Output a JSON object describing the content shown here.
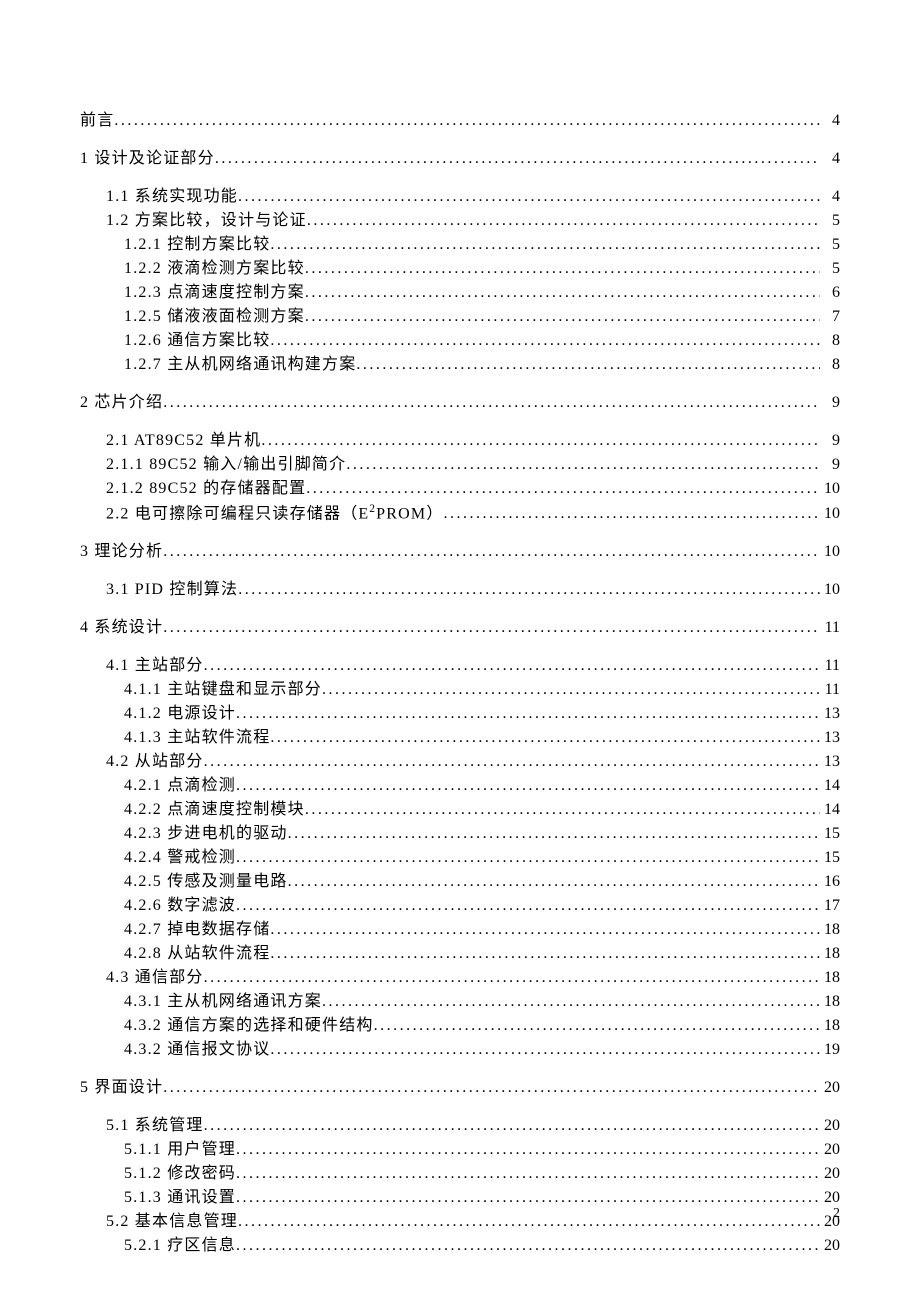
{
  "toc": [
    {
      "label": "前言",
      "page": "4",
      "level": 0
    },
    {
      "label": "1 设计及论证部分",
      "page": "4",
      "level": 0
    },
    {
      "label": "1.1 系统实现功能",
      "page": "4",
      "level": 1
    },
    {
      "label": "1.2 方案比较，设计与论证",
      "page": "5",
      "level": 1
    },
    {
      "label": "1.2.1 控制方案比较",
      "page": "5",
      "level": 2
    },
    {
      "label": "1.2.2 液滴检测方案比较",
      "page": "5",
      "level": 2
    },
    {
      "label": "1.2.3 点滴速度控制方案",
      "page": "6",
      "level": 2
    },
    {
      "label": "1.2.5 储液液面检测方案",
      "page": "7",
      "level": 2
    },
    {
      "label": "1.2.6 通信方案比较",
      "page": "8",
      "level": 2
    },
    {
      "label": "1.2.7 主从机网络通讯构建方案",
      "page": "8",
      "level": 2
    },
    {
      "label": "2 芯片介绍",
      "page": "9",
      "level": 0
    },
    {
      "label": "2.1 AT89C52 单片机",
      "page": "9",
      "level": 1
    },
    {
      "label": "2.1.1 89C52 输入/输出引脚简介",
      "page": "9",
      "level": 1
    },
    {
      "label": "2.1.2 89C52 的存储器配置",
      "page": "10",
      "level": 1
    },
    {
      "label": "2.2 电可擦除可编程只读存储器（E²PROM）",
      "page": "10",
      "level": 1,
      "html": "2.2 电可擦除可编程只读存储器（E<sup>2</sup>PROM）"
    },
    {
      "label": "3 理论分析",
      "page": "10",
      "level": 0
    },
    {
      "label": "3.1 PID 控制算法",
      "page": "10",
      "level": 1
    },
    {
      "label": "4 系统设计",
      "page": "11",
      "level": 0
    },
    {
      "label": "4.1 主站部分",
      "page": "11",
      "level": 1
    },
    {
      "label": "4.1.1 主站键盘和显示部分",
      "page": "11",
      "level": 2
    },
    {
      "label": "4.1.2 电源设计",
      "page": "13",
      "level": 2
    },
    {
      "label": "4.1.3 主站软件流程",
      "page": "13",
      "level": 2
    },
    {
      "label": "4.2 从站部分",
      "page": "13",
      "level": 1
    },
    {
      "label": "4.2.1 点滴检测",
      "page": "14",
      "level": 2
    },
    {
      "label": "4.2.2 点滴速度控制模块",
      "page": "14",
      "level": 2
    },
    {
      "label": "4.2.3 步进电机的驱动",
      "page": "15",
      "level": 2
    },
    {
      "label": "4.2.4 警戒检测",
      "page": "15",
      "level": 2
    },
    {
      "label": "4.2.5 传感及测量电路",
      "page": "16",
      "level": 2
    },
    {
      "label": "4.2.6 数字滤波",
      "page": "17",
      "level": 2
    },
    {
      "label": "4.2.7 掉电数据存储",
      "page": "18",
      "level": 2
    },
    {
      "label": "4.2.8 从站软件流程",
      "page": "18",
      "level": 2
    },
    {
      "label": "4.3 通信部分",
      "page": "18",
      "level": 1
    },
    {
      "label": "4.3.1 主从机网络通讯方案",
      "page": "18",
      "level": 2
    },
    {
      "label": "4.3.2 通信方案的选择和硬件结构",
      "page": "18",
      "level": 2
    },
    {
      "label": "4.3.2 通信报文协议",
      "page": "19",
      "level": 2
    },
    {
      "label": "5 界面设计",
      "page": "20",
      "level": 0
    },
    {
      "label": "5.1 系统管理",
      "page": "20",
      "level": 1
    },
    {
      "label": "5.1.1 用户管理",
      "page": "20",
      "level": 2
    },
    {
      "label": "5.1.2 修改密码",
      "page": "20",
      "level": 2
    },
    {
      "label": "5.1.3 通讯设置",
      "page": "20",
      "level": 2
    },
    {
      "label": "5.2 基本信息管理",
      "page": "20",
      "level": 1
    },
    {
      "label": "5.2.1 疗区信息",
      "page": "20",
      "level": 2
    }
  ],
  "footer": {
    "page_number": "2"
  }
}
